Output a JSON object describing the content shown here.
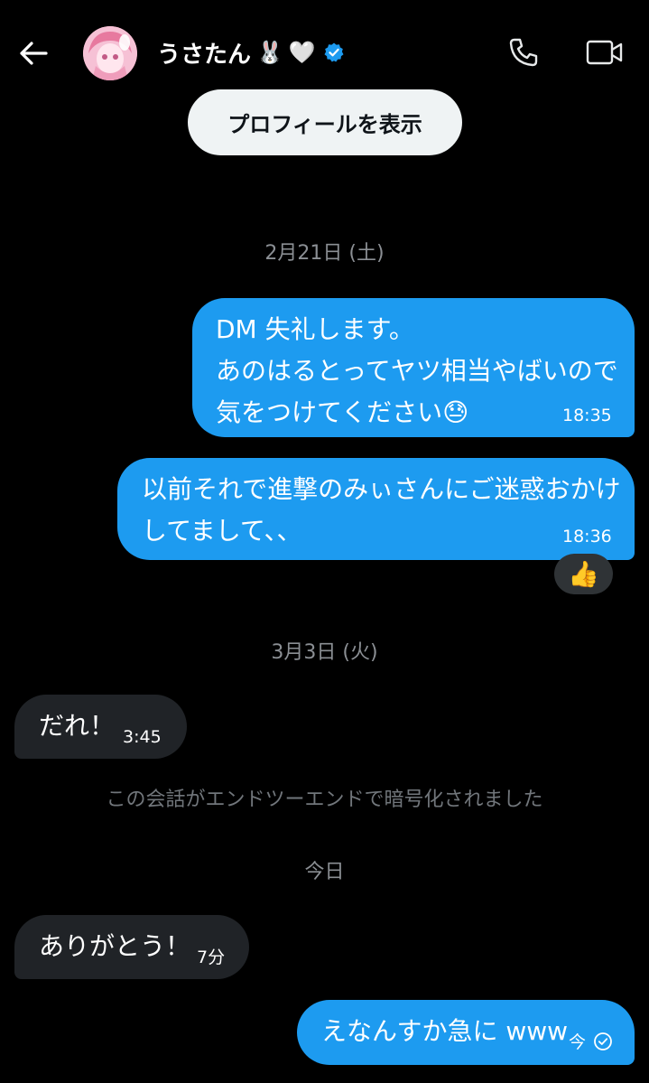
{
  "header": {
    "contact_name": "うさたん",
    "name_emoji_1": "🐰",
    "name_emoji_2": "🤍",
    "verified": true,
    "icons": [
      "back-arrow-icon",
      "phone-icon",
      "video-camera-icon",
      "verified-badge-icon"
    ]
  },
  "profile_button": {
    "label": "プロフィールを表示"
  },
  "colors": {
    "sent_bubble": "#1d9bf0",
    "received_bubble": "#202327",
    "verified": "#1d9bf0",
    "background": "#000000"
  },
  "messages": {
    "date_1": "2月21日 (土)",
    "msg_1": {
      "line_1": "DM 失礼します。",
      "line_2": "あのはるとってヤツ相当やばいので",
      "line_3": "気をつけてください😓",
      "time": "18:35"
    },
    "msg_2": {
      "line_1": "以前それで進撃のみぃさんにご迷惑おかけ",
      "line_2": "してまして、、",
      "time": "18:36",
      "reaction": "👍"
    },
    "date_2": "3月3日 (火)",
    "msg_3": {
      "text": "だれ！",
      "time": "3:45"
    },
    "encryption_notice": "この会話がエンドツーエンドで暗号化されました",
    "date_3": "今日",
    "msg_4": {
      "text": "ありがとう！",
      "time": "7分"
    },
    "msg_5": {
      "text": "えなんすか急に www",
      "time": "今",
      "status_icon": "read-check-icon"
    }
  }
}
